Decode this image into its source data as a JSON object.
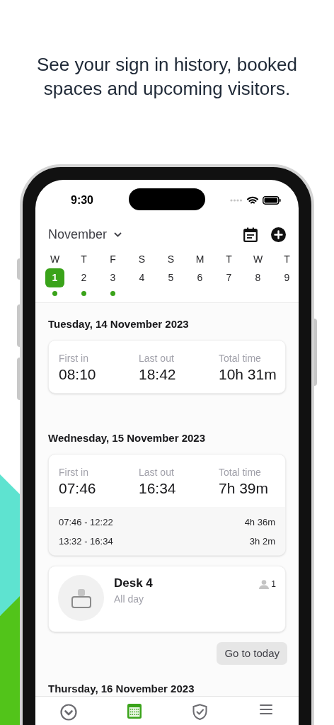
{
  "headline": "See your sign in history, booked spaces and upcoming visitors.",
  "status_bar": {
    "time": "9:30"
  },
  "month": {
    "label": "November"
  },
  "week": [
    {
      "weekday": "W",
      "date": "1",
      "selected": true,
      "event": true
    },
    {
      "weekday": "T",
      "date": "2",
      "selected": false,
      "event": true
    },
    {
      "weekday": "F",
      "date": "3",
      "selected": false,
      "event": true
    },
    {
      "weekday": "S",
      "date": "4",
      "selected": false,
      "event": false
    },
    {
      "weekday": "S",
      "date": "5",
      "selected": false,
      "event": false
    },
    {
      "weekday": "M",
      "date": "6",
      "selected": false,
      "event": false
    },
    {
      "weekday": "T",
      "date": "7",
      "selected": false,
      "event": false
    },
    {
      "weekday": "W",
      "date": "8",
      "selected": false,
      "event": false
    },
    {
      "weekday": "T",
      "date": "9",
      "selected": false,
      "event": false
    }
  ],
  "days": [
    {
      "heading": "Tuesday, 14 November 2023",
      "stats": [
        {
          "label": "First in",
          "value": "08:10"
        },
        {
          "label": "Last out",
          "value": "18:42"
        },
        {
          "label": "Total time",
          "value": "10h 31m"
        }
      ]
    },
    {
      "heading": "Wednesday, 15 November 2023",
      "stats": [
        {
          "label": "First in",
          "value": "07:46"
        },
        {
          "label": "Last out",
          "value": "16:34"
        },
        {
          "label": "Total time",
          "value": "7h 39m"
        }
      ],
      "sessions": [
        {
          "range": "07:46 - 12:22",
          "duration": "4h 36m"
        },
        {
          "range": "13:32 - 16:34",
          "duration": "3h 2m"
        }
      ],
      "bookings": [
        {
          "name": "Desk 4",
          "time": "All day",
          "attendees": "1"
        }
      ]
    }
  ],
  "go_to_today": "Go to today",
  "next_heading": "Thursday, 16 November 2023",
  "tabs": [
    {
      "kind": "home",
      "selected": false
    },
    {
      "kind": "calendar",
      "selected": true
    },
    {
      "kind": "shield",
      "selected": false
    },
    {
      "kind": "menu",
      "selected": false
    }
  ]
}
